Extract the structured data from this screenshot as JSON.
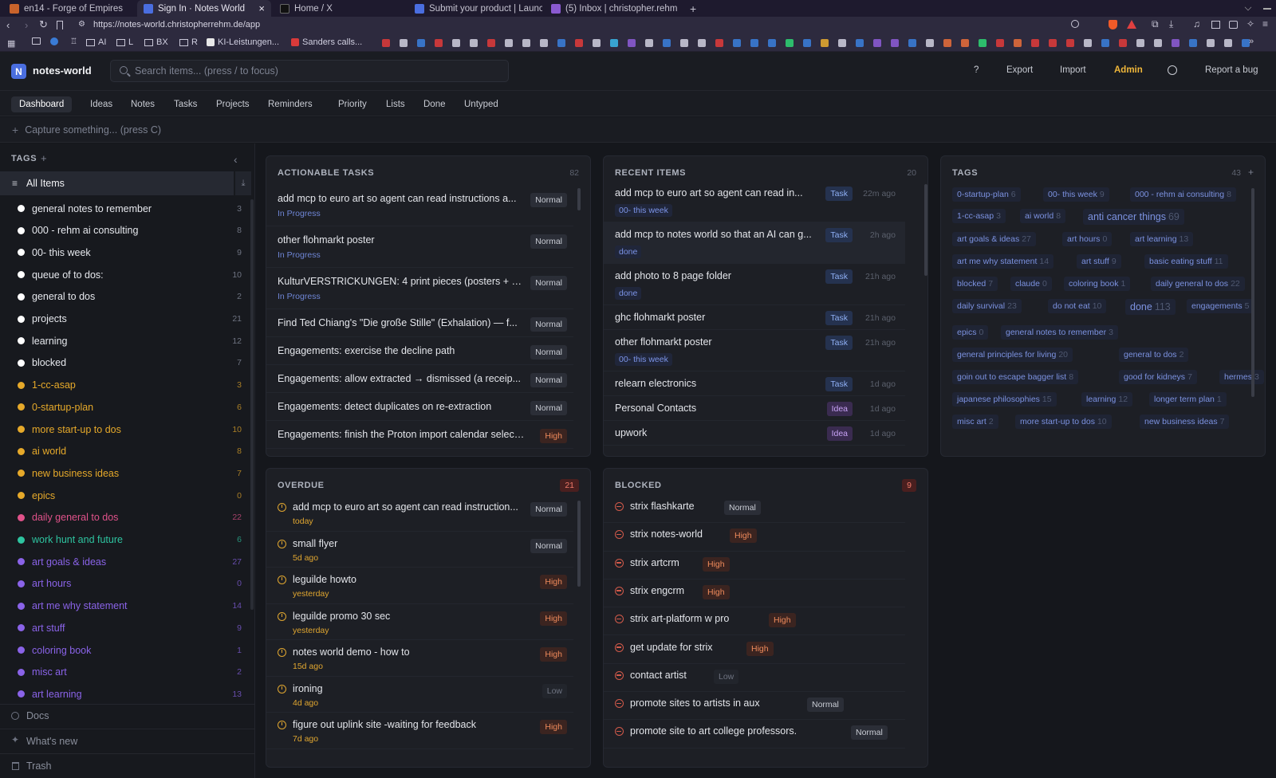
{
  "browser": {
    "tabs": [
      {
        "title": "en14 - Forge of Empires",
        "color": "#c9632b"
      },
      {
        "title": "Sign In · Notes World",
        "color": "#4a6ee0"
      },
      {
        "title": "Home / X",
        "color": "#000000"
      },
      {
        "title": "Submit your product | Launc",
        "color": "#4a6ee0"
      },
      {
        "title": "(5) Inbox | christopher.rehm",
        "color": "#8a5ad0"
      }
    ],
    "close_label": "×",
    "new_tab_label": "+",
    "url": "https://notes-world.christopherrehm.de/app",
    "bookmarks": [
      "AI",
      "L",
      "BX",
      "R",
      "KI-Leistungen...",
      "Sanders calls..."
    ]
  },
  "app": {
    "logo_letter": "N",
    "name": "notes-world",
    "search_placeholder": "Search items... (press / to focus)",
    "header_links": {
      "help": "?",
      "export": "Export",
      "import": "Import",
      "admin": "Admin",
      "report": "Report a bug"
    },
    "admin_color": "#f0b73a",
    "nav_tabs": [
      "Dashboard",
      "Ideas",
      "Notes",
      "Tasks",
      "Projects",
      "Reminders",
      "Priority",
      "Lists",
      "Done",
      "Untyped"
    ],
    "capture_placeholder": "Capture something... (press C)"
  },
  "sidebar": {
    "title": "TAGS",
    "add_label": "+",
    "all_items": "All Items",
    "tags": [
      {
        "name": "general notes to remember",
        "count": "3",
        "color": "#ffffff"
      },
      {
        "name": "000 - rehm ai consulting",
        "count": "8",
        "color": "#ffffff"
      },
      {
        "name": "00- this week",
        "count": "9",
        "color": "#ffffff"
      },
      {
        "name": "queue of to dos:",
        "count": "10",
        "color": "#ffffff"
      },
      {
        "name": "general to dos",
        "count": "2",
        "color": "#ffffff"
      },
      {
        "name": "projects",
        "count": "21",
        "color": "#ffffff"
      },
      {
        "name": "learning",
        "count": "12",
        "color": "#ffffff"
      },
      {
        "name": "blocked",
        "count": "7",
        "color": "#ffffff"
      },
      {
        "name": "1-cc-asap",
        "count": "3",
        "color": "#e6a92a"
      },
      {
        "name": "0-startup-plan",
        "count": "6",
        "color": "#e6a92a"
      },
      {
        "name": "more start-up to dos",
        "count": "10",
        "color": "#e6a92a"
      },
      {
        "name": "ai world",
        "count": "8",
        "color": "#e6a92a"
      },
      {
        "name": "new business ideas",
        "count": "7",
        "color": "#e6a92a"
      },
      {
        "name": "epics",
        "count": "0",
        "color": "#e6a92a"
      },
      {
        "name": "daily general to dos",
        "count": "22",
        "color": "#e0528a"
      },
      {
        "name": "work hunt and future",
        "count": "6",
        "color": "#2ec4a0"
      },
      {
        "name": "art goals & ideas",
        "count": "27",
        "color": "#8a63e8"
      },
      {
        "name": "art hours",
        "count": "0",
        "color": "#8a63e8"
      },
      {
        "name": "art me why statement",
        "count": "14",
        "color": "#8a63e8"
      },
      {
        "name": "art stuff",
        "count": "9",
        "color": "#8a63e8"
      },
      {
        "name": "coloring book",
        "count": "1",
        "color": "#8a63e8"
      },
      {
        "name": "misc art",
        "count": "2",
        "color": "#8a63e8"
      },
      {
        "name": "art learning",
        "count": "13",
        "color": "#8a63e8"
      }
    ],
    "footer": [
      "Docs",
      "What's new",
      "Trash"
    ]
  },
  "actionable": {
    "title": "ACTIONABLE TASKS",
    "count": "82",
    "items": [
      {
        "title": "add mcp to euro art so agent can read instructions a...",
        "status": "In Progress",
        "priority": "Normal"
      },
      {
        "title": "other flohmarkt poster",
        "status": "In Progress",
        "priority": "Normal"
      },
      {
        "title": "KulturVERSTRICKUNGEN: 4 print pieces (posters + s...",
        "status": "In Progress",
        "priority": "Normal"
      },
      {
        "title": "Find Ted Chiang's \"Die große Stille\" (Exhalation) — f...",
        "status": "",
        "priority": "Normal"
      },
      {
        "title": "Engagements: exercise the decline path",
        "status": "",
        "priority": "Normal"
      },
      {
        "title": "Engagements: allow extracted → dismissed (a receip...",
        "status": "",
        "priority": "Normal"
      },
      {
        "title": "Engagements: detect duplicates on re-extraction",
        "status": "",
        "priority": "Normal"
      },
      {
        "title": "Engagements: finish the Proton import calendar selector",
        "status": "",
        "priority": "High"
      }
    ]
  },
  "recent": {
    "title": "RECENT ITEMS",
    "count": "20",
    "items": [
      {
        "title": "add mcp to euro art so agent can read in...",
        "type": "Task",
        "age": "22m ago",
        "tag": "00- this week"
      },
      {
        "title": "add mcp to notes world so that an AI can g...",
        "type": "Task",
        "age": "2h ago",
        "tag": "done"
      },
      {
        "title": "add photo to 8 page folder",
        "type": "Task",
        "age": "21h ago",
        "tag": "done"
      },
      {
        "title": "ghc flohmarkt poster",
        "type": "Task",
        "age": "21h ago",
        "tag": ""
      },
      {
        "title": "other flohmarkt poster",
        "type": "Task",
        "age": "21h ago",
        "tag": "00- this week"
      },
      {
        "title": "relearn electronics",
        "type": "Task",
        "age": "1d ago",
        "tag": ""
      },
      {
        "title": "Personal Contacts",
        "type": "Idea",
        "age": "1d ago",
        "tag": ""
      },
      {
        "title": "upwork",
        "type": "Idea",
        "age": "1d ago",
        "tag": ""
      }
    ]
  },
  "tags_card": {
    "title": "TAGS",
    "count": "43",
    "add_label": "+",
    "rows": [
      [
        {
          "name": "0-startup-plan",
          "n": "6"
        },
        {
          "name": "00- this week",
          "n": "9"
        },
        {
          "name": "000 - rehm ai consulting",
          "n": "8"
        }
      ],
      [
        {
          "name": "1-cc-asap",
          "n": "3"
        },
        {
          "name": "ai world",
          "n": "8"
        },
        {
          "name": "anti cancer things",
          "n": "69",
          "big": true
        }
      ],
      [
        {
          "name": "art goals & ideas",
          "n": "27"
        },
        {
          "name": "art hours",
          "n": "0"
        },
        {
          "name": "art learning",
          "n": "13"
        }
      ],
      [
        {
          "name": "art me why statement",
          "n": "14"
        },
        {
          "name": "art stuff",
          "n": "9"
        },
        {
          "name": "basic eating stuff",
          "n": "11"
        }
      ],
      [
        {
          "name": "blocked",
          "n": "7"
        },
        {
          "name": "claude",
          "n": "0"
        },
        {
          "name": "coloring book",
          "n": "1"
        },
        {
          "name": "daily general to dos",
          "n": "22"
        }
      ],
      [
        {
          "name": "daily survival",
          "n": "23"
        },
        {
          "name": "do not eat",
          "n": "10"
        },
        {
          "name": "done",
          "n": "113",
          "big": true
        },
        {
          "name": "engagements",
          "n": "5"
        }
      ],
      [
        {
          "name": "epics",
          "n": "0"
        },
        {
          "name": "general notes to remember",
          "n": "3"
        }
      ],
      [
        {
          "name": "general principles for living",
          "n": "20"
        },
        {
          "name": "general to dos",
          "n": "2"
        }
      ],
      [
        {
          "name": "goin out to escape bagger list",
          "n": "8"
        },
        {
          "name": "good for kidneys",
          "n": "7"
        },
        {
          "name": "hermes",
          "n": "3"
        }
      ],
      [
        {
          "name": "japanese philosophies",
          "n": "15"
        },
        {
          "name": "learning",
          "n": "12"
        },
        {
          "name": "longer term plan",
          "n": "1"
        }
      ],
      [
        {
          "name": "misc art",
          "n": "2"
        },
        {
          "name": "more start-up to dos",
          "n": "10"
        },
        {
          "name": "new business ideas",
          "n": "7"
        }
      ]
    ]
  },
  "overdue": {
    "title": "OVERDUE",
    "count": "21",
    "items": [
      {
        "title": "add mcp to euro art so agent can read instruction...",
        "date": "today",
        "priority": "Normal"
      },
      {
        "title": "small flyer",
        "date": "5d ago",
        "priority": "Normal"
      },
      {
        "title": "leguilde howto",
        "date": "yesterday",
        "priority": "High"
      },
      {
        "title": "leguilde promo 30 sec",
        "date": "yesterday",
        "priority": "High"
      },
      {
        "title": "notes world demo - how to",
        "date": "15d ago",
        "priority": "High"
      },
      {
        "title": "ironing",
        "date": "4d ago",
        "priority": "Low"
      },
      {
        "title": "figure out uplink site -waiting for feedback",
        "date": "7d ago",
        "priority": "High"
      }
    ]
  },
  "blocked": {
    "title": "BLOCKED",
    "count": "9",
    "items": [
      {
        "title": "strix flashkarte",
        "priority": "Normal"
      },
      {
        "title": "strix notes-world",
        "priority": "High"
      },
      {
        "title": "strix artcrm",
        "priority": "High"
      },
      {
        "title": "strix engcrm",
        "priority": "High"
      },
      {
        "title": "strix art-platform w pro",
        "priority": "High"
      },
      {
        "title": "get update for strix",
        "priority": "High"
      },
      {
        "title": "contact artist",
        "priority": "Low"
      },
      {
        "title": "promote sites to artists in aux",
        "priority": "Normal"
      },
      {
        "title": "promote site to art college professors.",
        "priority": "Normal"
      }
    ]
  }
}
